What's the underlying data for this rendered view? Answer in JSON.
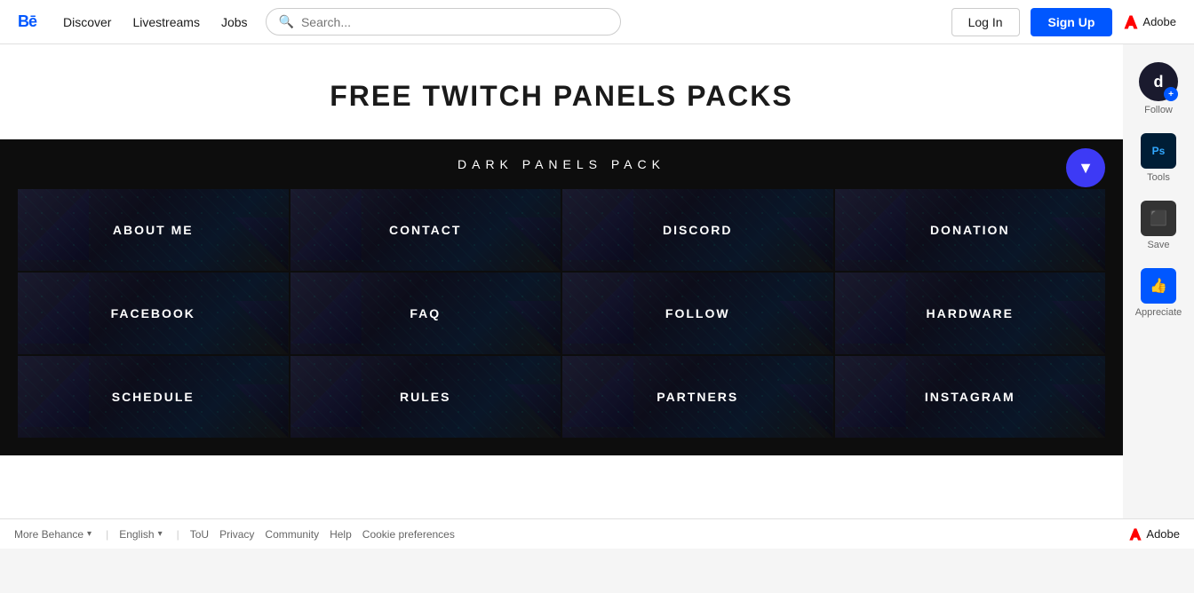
{
  "header": {
    "logo": "Bē",
    "nav": [
      {
        "label": "Discover",
        "id": "discover"
      },
      {
        "label": "Livestreams",
        "id": "livestreams"
      },
      {
        "label": "Jobs",
        "id": "jobs"
      }
    ],
    "search_placeholder": "Search...",
    "login_label": "Log In",
    "signup_label": "Sign Up",
    "adobe_label": "Adobe"
  },
  "project": {
    "title": "FREE TWITCH PANELS PACKS",
    "dark_panel_title": "DARK PANELS PACK",
    "v_icon": "▼",
    "panels": [
      {
        "label": "ABOUT ME"
      },
      {
        "label": "CONTACT"
      },
      {
        "label": "DISCORD"
      },
      {
        "label": "DONATION"
      },
      {
        "label": "FACEBOOK"
      },
      {
        "label": "FAQ"
      },
      {
        "label": "FOLLOW"
      },
      {
        "label": "HARDWARE"
      },
      {
        "label": "SCHEDULE"
      },
      {
        "label": "RULES"
      },
      {
        "label": "PARTNERS"
      },
      {
        "label": "INSTAGRAM"
      }
    ]
  },
  "sidebar": {
    "avatar_letter": "d",
    "follow_label": "Follow",
    "tools_label": "Tools",
    "save_label": "Save",
    "appreciate_label": "Appreciate",
    "ps_icon": "Ps"
  },
  "footer": {
    "more_behance": "More Behance",
    "language": "English",
    "tou": "ToU",
    "privacy": "Privacy",
    "community": "Community",
    "help": "Help",
    "cookie": "Cookie preferences",
    "adobe_label": "Adobe"
  }
}
